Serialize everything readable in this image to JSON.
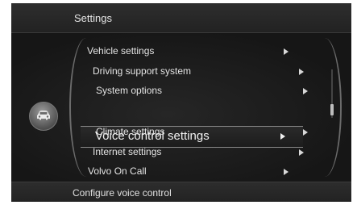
{
  "header": {
    "title": "Settings"
  },
  "menu": {
    "items": [
      {
        "label": "Vehicle settings"
      },
      {
        "label": "Driving support system"
      },
      {
        "label": "System options"
      },
      {
        "label": "Voice control settings",
        "selected": true
      },
      {
        "label": "Climate settings"
      },
      {
        "label": "Internet settings"
      },
      {
        "label": "Volvo On Call"
      }
    ],
    "arrow_icon": "triangle-right-icon",
    "side_icon": "car-icon"
  },
  "status": {
    "text": "Configure voice control"
  }
}
